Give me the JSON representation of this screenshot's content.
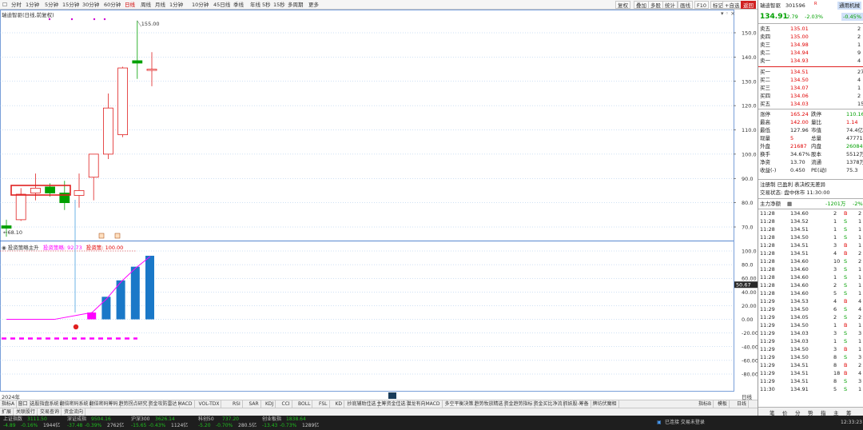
{
  "toolbar": {
    "periods": [
      "分时",
      "1分钟",
      "5分钟",
      "15分钟",
      "30分钟",
      "60分钟",
      "日线",
      "周线",
      "月线",
      "1分钟",
      "10分钟",
      "45日线",
      "季线",
      "年线",
      "5秒",
      "15秒",
      "多周期",
      "更多"
    ],
    "active_period": "日线",
    "right_buttons": [
      "复权",
      "叠加",
      "多股",
      "统计",
      "画线",
      "F10",
      "标记",
      "+自选",
      "返回"
    ]
  },
  "chart": {
    "title": "瑞迪智驱(日线,前复权)",
    "price_ticks": [
      "150.0",
      "140.0",
      "130.0",
      "120.0",
      "110.0",
      "100.0",
      "90.0",
      "80.0",
      "70.0"
    ],
    "high_label": "155.00",
    "low_label": "68.10",
    "indicator_legend": {
      "name": "投资策略主升",
      "v1_label": "投资策略:",
      "v1": "92.73",
      "v2_label": "投资策:",
      "v2": "100.00"
    },
    "indicator_ticks": [
      "100.0",
      "80.0",
      "60.00",
      "40.00",
      "20.00",
      "0.00",
      "-20.00",
      "-40.00",
      "-60.00",
      "-80.00"
    ],
    "year_label": "2024年",
    "axis_extra": "日线",
    "cursor_value": "50.67",
    "candles": [
      {
        "o": 70.5,
        "c": 69.5,
        "h": 73.0,
        "l": 66.0
      },
      {
        "o": 73.0,
        "c": 83.5,
        "h": 86.0,
        "l": 72.5
      },
      {
        "o": 84.0,
        "c": 86.0,
        "h": 92.0,
        "l": 81.0
      },
      {
        "o": 86.5,
        "c": 84.0,
        "h": 88.0,
        "l": 82.5
      },
      {
        "o": 84.0,
        "c": 80.0,
        "h": 89.0,
        "l": 77.0
      },
      {
        "o": 83.0,
        "c": 85.0,
        "h": 92.0,
        "l": 78.0
      },
      {
        "o": 90.5,
        "c": 100.0,
        "h": 100.0,
        "l": 81.0
      },
      {
        "o": 100.0,
        "c": 119.0,
        "h": 125.0,
        "l": 98.0
      },
      {
        "o": 108.0,
        "c": 135.5,
        "h": 136.0,
        "l": 107.0
      },
      {
        "o": 138.5,
        "c": 137.5,
        "h": 155.0,
        "l": 131.0
      },
      {
        "o": 134.5,
        "c": 135.0,
        "h": 142.0,
        "l": 128.0
      }
    ],
    "bars": [
      {
        "v": 10,
        "color": "#ff00ff"
      },
      {
        "v": 33,
        "color": "#1a78c8"
      },
      {
        "v": 57,
        "color": "#1a78c8"
      },
      {
        "v": 77,
        "color": "#1a78c8"
      },
      {
        "v": 93,
        "color": "#1a78c8"
      }
    ],
    "line": [
      0,
      0,
      0,
      0,
      10,
      30,
      55,
      75,
      92
    ]
  },
  "tabs_row1": [
    "指标A",
    "窗口",
    "选股指盘系统",
    "翻倍密码系统",
    "翻倍密码筹码",
    "趋势拐点研究",
    "资金攻防雷达",
    "MACD",
    "VOL-TDX",
    "RSI",
    "SAR",
    "KDJ",
    "CCI",
    "BOLL",
    "FSL",
    "KD",
    "抄底辅助佳选",
    "主筹资金佳选",
    "潜龙有向MACD",
    "多空平衡决策",
    "趋势牧放精选",
    "资金趋势指标",
    "资金买比净流",
    "抓妖股-筹备",
    "牌坊伏魔相",
    "指标B",
    "模板",
    "日线"
  ],
  "tabs_row2": [
    "扩展",
    "关联股行",
    "交易查询",
    "资金流向"
  ],
  "status": {
    "indices": [
      {
        "name": "上证指数",
        "value": "3111.50",
        "chg": "-4.89",
        "pct": "-0.16%",
        "amt": "1944亿"
      },
      {
        "name": "深证成指",
        "value": "9504.16",
        "chg": "-37.48",
        "pct": "-0.39%",
        "amt": "2762亿"
      },
      {
        "name": "沪深300",
        "value": "3626.14",
        "chg": "-15.65",
        "pct": "-0.43%",
        "amt": "1124亿"
      },
      {
        "name": "科创50",
        "value": "737.20",
        "chg": "-5.20",
        "pct": "-0.70%",
        "amt": "280.5亿"
      },
      {
        "name": "创业板指",
        "value": "1838.64",
        "chg": "-13.43",
        "pct": "-0.73%",
        "amt": "1289亿"
      }
    ],
    "connect": "已连接 交易未登录",
    "time": "12:33:23"
  },
  "panel": {
    "name": "瑞迪智驱",
    "code": "301596",
    "badge": "R",
    "sector": "通用机械",
    "price": "134.91",
    "chg": "-2.79",
    "pct": "-2.03%",
    "sector_pct": "-0.45%",
    "asks": [
      {
        "label": "卖五",
        "price": "135.01",
        "vol": "2"
      },
      {
        "label": "卖四",
        "price": "135.00",
        "vol": "2"
      },
      {
        "label": "卖三",
        "price": "134.98",
        "vol": "1"
      },
      {
        "label": "卖二",
        "price": "134.94",
        "vol": "9"
      },
      {
        "label": "卖一",
        "price": "134.93",
        "vol": "4"
      }
    ],
    "bids": [
      {
        "label": "买一",
        "price": "134.51",
        "vol": "27"
      },
      {
        "label": "买二",
        "price": "134.50",
        "vol": "4"
      },
      {
        "label": "买三",
        "price": "134.07",
        "vol": "1"
      },
      {
        "label": "买四",
        "price": "134.06",
        "vol": "2"
      },
      {
        "label": "买五",
        "price": "134.03",
        "vol": "15"
      }
    ],
    "stats": [
      {
        "l1": "涨停",
        "v1": "165.24",
        "l2": "跌停",
        "v2": "110.16",
        "c1": "red",
        "c2": "grn"
      },
      {
        "l1": "最高",
        "v1": "142.00",
        "l2": "量比",
        "v2": "1.14",
        "c1": "red",
        "c2": "red"
      },
      {
        "l1": "最低",
        "v1": "127.96",
        "l2": "市值",
        "v2": "74.4亿",
        "c1": "",
        "c2": ""
      },
      {
        "l1": "现量",
        "v1": "5",
        "l2": "总量",
        "v2": "47771",
        "c1": "red",
        "c2": ""
      },
      {
        "l1": "外盘",
        "v1": "21687",
        "l2": "内盘",
        "v2": "26084",
        "c1": "red",
        "c2": "grn"
      },
      {
        "l1": "换手",
        "v1": "34.67%",
        "l2": "股本",
        "v2": "5512万",
        "c1": "",
        "c2": ""
      },
      {
        "l1": "净资",
        "v1": "13.70",
        "l2": "流通",
        "v2": "1378万",
        "c1": "",
        "c2": ""
      },
      {
        "l1": "收益(-)",
        "v1": "0.450",
        "l2": "PE(动)",
        "v2": "75.3",
        "c1": "",
        "c2": ""
      }
    ],
    "info1": "注册制 已盈利 表决权无差异",
    "info2": "交易状态: 盘中休市 11:30:00",
    "flow_label": "主力净额",
    "flow_value": "-1201万",
    "flow_pct": "-2%",
    "ticks": [
      {
        "t": "11:28",
        "p": "134.60",
        "v": "2",
        "s": "B",
        "n": "2"
      },
      {
        "t": "11:28",
        "p": "134.52",
        "v": "1",
        "s": "S",
        "n": "1"
      },
      {
        "t": "11:28",
        "p": "134.51",
        "v": "1",
        "s": "S",
        "n": "1"
      },
      {
        "t": "11:28",
        "p": "134.50",
        "v": "1",
        "s": "S",
        "n": "1"
      },
      {
        "t": "11:28",
        "p": "134.51",
        "v": "3",
        "s": "B",
        "n": "1"
      },
      {
        "t": "11:28",
        "p": "134.51",
        "v": "4",
        "s": "B",
        "n": "2"
      },
      {
        "t": "11:28",
        "p": "134.60",
        "v": "10",
        "s": "S",
        "n": "2"
      },
      {
        "t": "11:28",
        "p": "134.60",
        "v": "3",
        "s": "S",
        "n": "1"
      },
      {
        "t": "11:28",
        "p": "134.60",
        "v": "1",
        "s": "S",
        "n": "1"
      },
      {
        "t": "11:28",
        "p": "134.60",
        "v": "2",
        "s": "S",
        "n": "1"
      },
      {
        "t": "11:28",
        "p": "134.60",
        "v": "5",
        "s": "S",
        "n": "1"
      },
      {
        "t": "11:29",
        "p": "134.53",
        "v": "4",
        "s": "B",
        "n": "4"
      },
      {
        "t": "11:29",
        "p": "134.50",
        "v": "6",
        "s": "S",
        "n": "4"
      },
      {
        "t": "11:29",
        "p": "134.05",
        "v": "2",
        "s": "S",
        "n": "2"
      },
      {
        "t": "11:29",
        "p": "134.50",
        "v": "1",
        "s": "B",
        "n": "1"
      },
      {
        "t": "11:29",
        "p": "134.03",
        "v": "3",
        "s": "S",
        "n": "3"
      },
      {
        "t": "11:29",
        "p": "134.03",
        "v": "1",
        "s": "S",
        "n": "1"
      },
      {
        "t": "11:29",
        "p": "134.50",
        "v": "3",
        "s": "B",
        "n": "1"
      },
      {
        "t": "11:29",
        "p": "134.50",
        "v": "8",
        "s": "S",
        "n": "3"
      },
      {
        "t": "11:29",
        "p": "134.51",
        "v": "8",
        "s": "B",
        "n": "2"
      },
      {
        "t": "11:29",
        "p": "134.51",
        "v": "18",
        "s": "B",
        "n": "4"
      },
      {
        "t": "11:29",
        "p": "134.51",
        "v": "8",
        "s": "S",
        "n": "3"
      },
      {
        "t": "11:30",
        "p": "134.91",
        "v": "5",
        "s": "S",
        "n": "1"
      }
    ],
    "bottom_tabs": [
      "笔",
      "价",
      "分",
      "势",
      "指",
      "主",
      "筹"
    ]
  }
}
